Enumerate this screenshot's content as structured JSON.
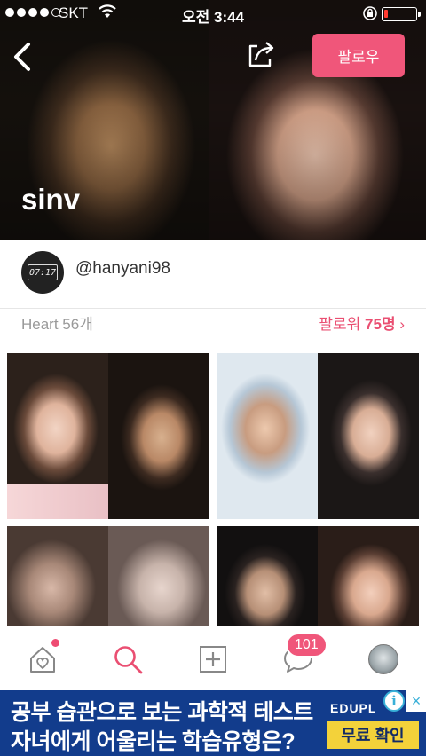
{
  "status_bar": {
    "carrier": "SKT",
    "time": "오전 3:44",
    "signal_bars": 4,
    "battery_level": 0.12,
    "battery_color": "#ff3b30"
  },
  "header": {
    "back_icon": "chevron-left-icon",
    "share_icon": "share-icon",
    "follow_label": "팔로우",
    "profile_name": "sinv",
    "accent_color": "#f0567a"
  },
  "profile": {
    "avatar_text": "07:17",
    "username": "@hanyani98",
    "heart_label": "Heart 56개",
    "followers_prefix": "팔로워",
    "followers_count": "75명",
    "followers_chevron": "›"
  },
  "tabs": {
    "items": [
      {
        "name": "home",
        "icon": "home-heart-icon",
        "has_notification": true
      },
      {
        "name": "search",
        "icon": "search-icon"
      },
      {
        "name": "add",
        "icon": "add-box-icon"
      },
      {
        "name": "chat",
        "icon": "chat-bubble-icon",
        "badge": "101"
      },
      {
        "name": "profile",
        "icon": "profile-avatar-icon"
      }
    ]
  },
  "ad": {
    "line1": "공부 습관으로 보는 과학적 테스트",
    "line2": "자녀에게 어울리는 학습유형은?",
    "brand": "EDUPL",
    "cta": "무료 확인",
    "info_glyph": "i",
    "close_glyph": "×",
    "bg_color": "#123c8c",
    "cta_color": "#f3d23a"
  }
}
